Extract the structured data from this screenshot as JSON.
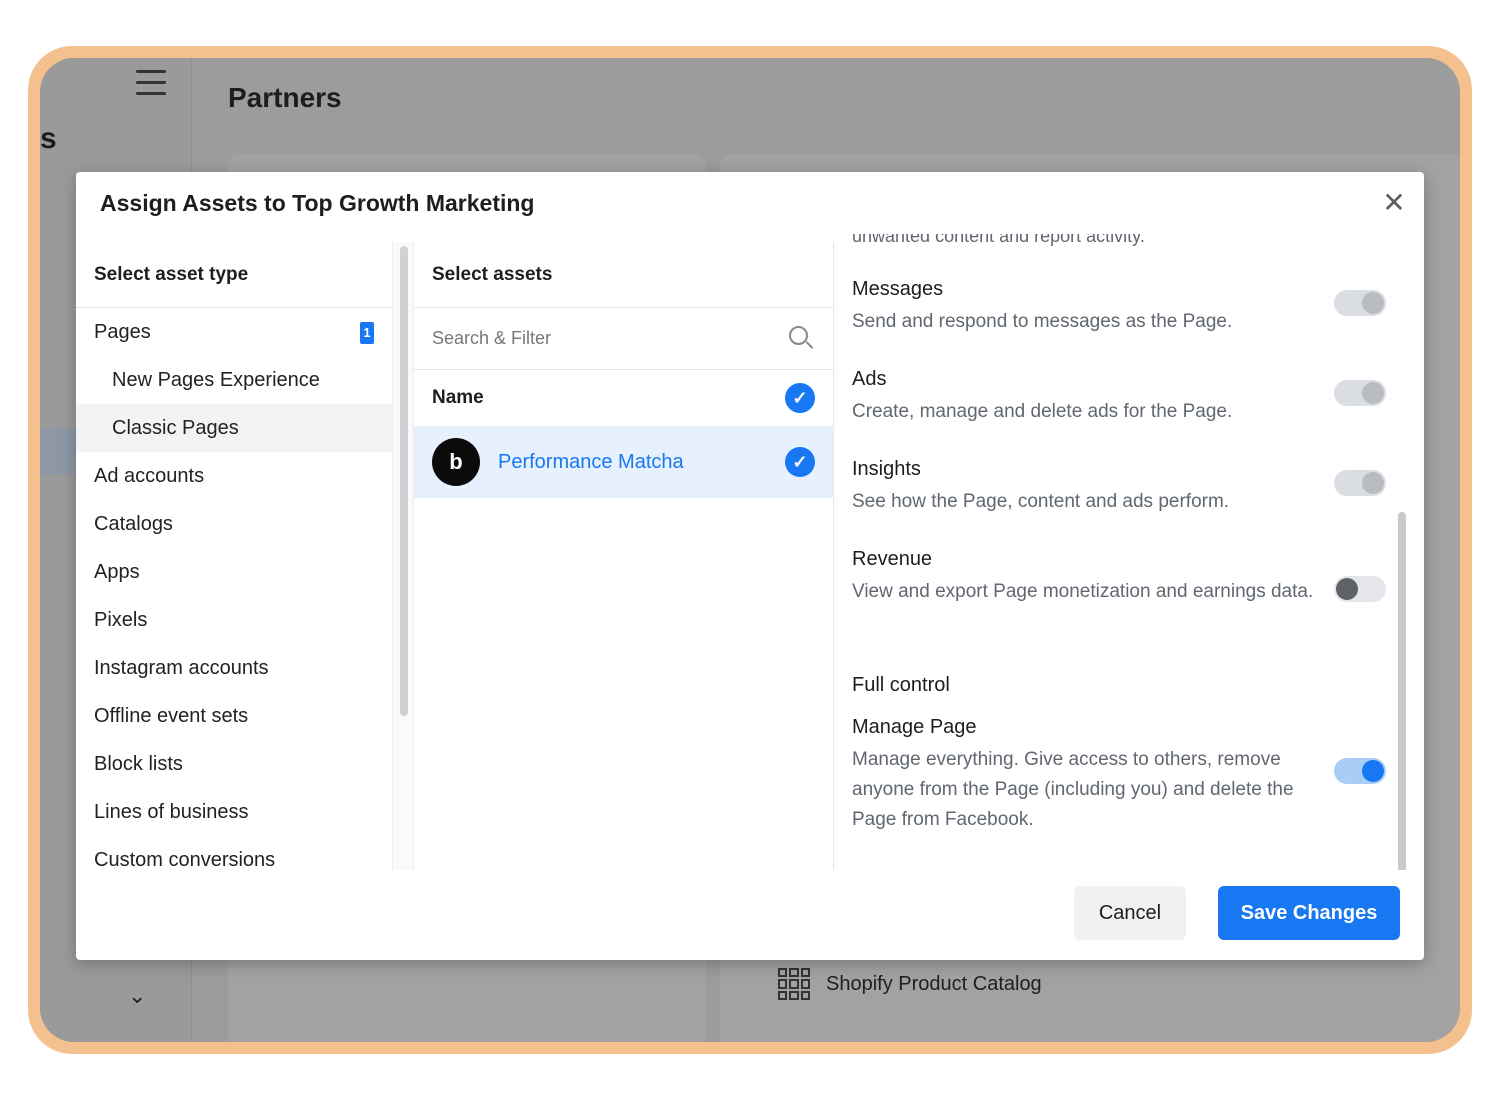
{
  "background": {
    "sidebar_cut_letter": "s",
    "page_title": "Partners",
    "catalog_item": "Shopify Product Catalog"
  },
  "modal": {
    "title": "Assign Assets to Top Growth Marketing",
    "close_icon": "close-icon",
    "left": {
      "header": "Select asset type",
      "items": [
        {
          "label": "Pages",
          "badge": "1"
        },
        {
          "label": "New Pages Experience"
        },
        {
          "label": "Classic Pages"
        },
        {
          "label": "Ad accounts"
        },
        {
          "label": "Catalogs"
        },
        {
          "label": "Apps"
        },
        {
          "label": "Pixels"
        },
        {
          "label": "Instagram accounts"
        },
        {
          "label": "Offline event sets"
        },
        {
          "label": "Block lists"
        },
        {
          "label": "Lines of business"
        },
        {
          "label": "Custom conversions"
        }
      ]
    },
    "middle": {
      "header": "Select assets",
      "search_placeholder": "Search & Filter",
      "name_header": "Name",
      "assets": [
        {
          "name": "Performance Matcha",
          "avatar_letter": "b",
          "selected": true
        }
      ]
    },
    "right": {
      "cut_text": "unwanted content and report activity.",
      "permissions": [
        {
          "title": "Messages",
          "desc": "Send and respond to messages as the Page.",
          "state": "on-disabled"
        },
        {
          "title": "Ads",
          "desc": "Create, manage and delete ads for the Page.",
          "state": "on-disabled"
        },
        {
          "title": "Insights",
          "desc": "See how the Page, content and ads perform.",
          "state": "on-disabled"
        },
        {
          "title": "Revenue",
          "desc": "View and export Page monetization and earnings data.",
          "state": "off"
        }
      ],
      "section_label": "Full control",
      "full_control": {
        "title": "Manage Page",
        "desc": "Manage everything. Give access to others, remove anyone from the Page (including you) and delete the Page from Facebook.",
        "state": "on"
      }
    },
    "footer": {
      "cancel_label": "Cancel",
      "save_label": "Save Changes"
    }
  },
  "colors": {
    "accent": "#1877f2",
    "frame": "#f4c08e"
  }
}
